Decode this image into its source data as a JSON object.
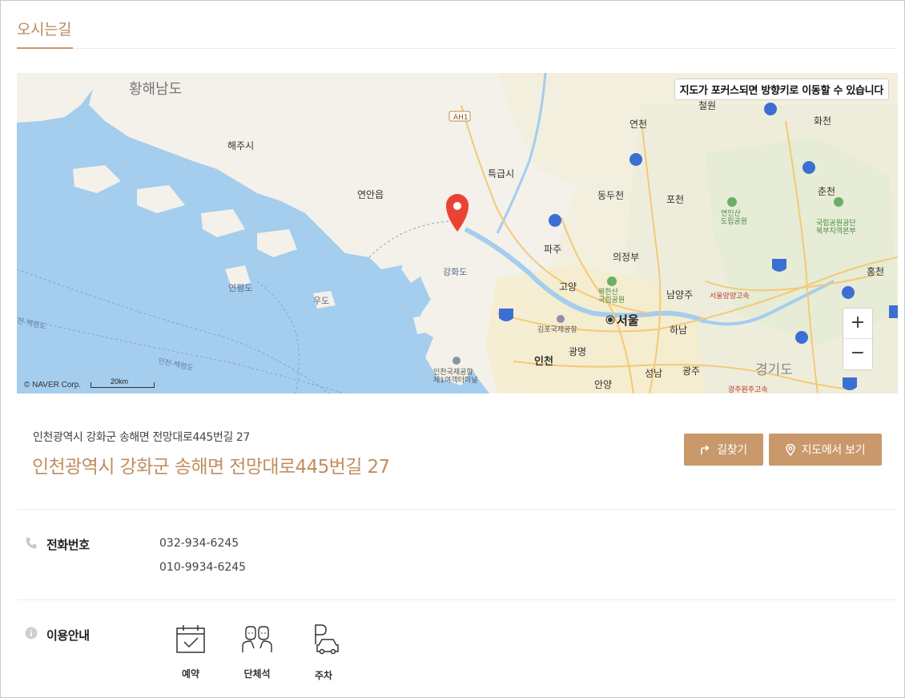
{
  "tabs": {
    "active": "오시는길"
  },
  "map": {
    "notice": "지도가 포커스되면 방향키로 이동할 수 있습니다",
    "copyright": "© NAVER Corp.",
    "scale": "20km",
    "zoom_in": "+",
    "zoom_out": "−",
    "labels": {
      "hwanghae": "황해남도",
      "haeju": "해주시",
      "yeonan": "연안읍",
      "gaepung": "특급시",
      "cheorwon": "철원",
      "yeoncheon": "연천",
      "hwacheon": "화천",
      "dongducheon": "동두천",
      "pocheon": "포천",
      "yeonin_park": "연인산\n도립공원",
      "chuncheon": "춘천",
      "national_park": "국립공원공단\n북부지역본부",
      "ganghwa": "강화도",
      "paju": "파주",
      "uijeongbu": "의정부",
      "yeonpyeong": "연평도",
      "udo": "우도",
      "goyang": "고양",
      "bukhansan": "북한산\n국립공원",
      "namyangju": "남양주",
      "seoul_yangyang": "서울양양고속",
      "hongcheon": "홍천",
      "seoul": "서울",
      "gimpo_airport": "김포국제공항",
      "hanam": "하남",
      "incheon": "인천",
      "gwangmyeong": "광명",
      "gyeonggi": "경기도",
      "incheon_baengnyeong": "인천-백령도",
      "incheon_baeng_left": "천-백령도",
      "incheon_airport": "인천국제공항\n제1여객터미널",
      "seongnam": "성남",
      "gwangju": "광주",
      "anyang": "안양",
      "gwangju_wonju": "광주원주고속",
      "ah1": "AH1"
    }
  },
  "address": {
    "small": "인천광역시 강화군 송해면 전망대로445번길 27",
    "big": "인천광역시 강화군 송해면 전망대로445번길 27"
  },
  "buttons": {
    "route": "길찾기",
    "view_map": "지도에서 보기"
  },
  "phone": {
    "label": "전화번호",
    "numbers": [
      "032-934-6245",
      "010-9934-6245"
    ]
  },
  "info": {
    "label": "이용안내",
    "amenities": [
      {
        "label": "예약",
        "icon": "calendar-check-icon"
      },
      {
        "label": "단체석",
        "icon": "group-seat-icon"
      },
      {
        "label": "주차",
        "icon": "parking-car-icon"
      }
    ]
  },
  "colors": {
    "accent": "#c9996b",
    "accent_text": "#c08e5e",
    "water": "#a4cdee",
    "land": "#f3f1ea",
    "marker": "#ea4335"
  }
}
